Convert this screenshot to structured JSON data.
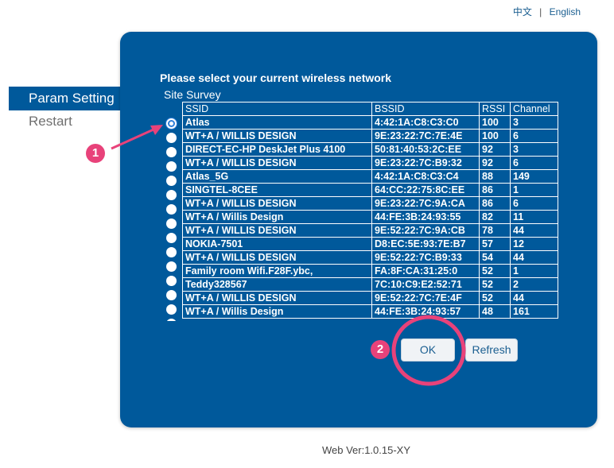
{
  "language": {
    "chinese": "中文",
    "separator": "|",
    "english": "English"
  },
  "sidebar": {
    "items": [
      {
        "label": "Param Setting",
        "active": true
      },
      {
        "label": "Restart",
        "active": false
      }
    ]
  },
  "panel": {
    "title": "Please select your current wireless network",
    "survey_label": "Site Survey",
    "columns": [
      "SSID",
      "BSSID",
      "RSSI",
      "Channel"
    ],
    "rows": [
      {
        "ssid": "Atlas",
        "bssid": "4:42:1A:C8:C3:C0",
        "rssi": "100",
        "channel": "3",
        "selected": true
      },
      {
        "ssid": "WT+A / WILLIS DESIGN",
        "bssid": "9E:23:22:7C:7E:4E",
        "rssi": "100",
        "channel": "6"
      },
      {
        "ssid": "DIRECT-EC-HP DeskJet Plus 4100",
        "bssid": "50:81:40:53:2C:EE",
        "rssi": "92",
        "channel": "3"
      },
      {
        "ssid": "WT+A / WILLIS DESIGN",
        "bssid": "9E:23:22:7C:B9:32",
        "rssi": "92",
        "channel": "6"
      },
      {
        "ssid": "Atlas_5G",
        "bssid": "4:42:1A:C8:C3:C4",
        "rssi": "88",
        "channel": "149"
      },
      {
        "ssid": "SINGTEL-8CEE",
        "bssid": "64:CC:22:75:8C:EE",
        "rssi": "86",
        "channel": "1"
      },
      {
        "ssid": "WT+A / WILLIS DESIGN",
        "bssid": "9E:23:22:7C:9A:CA",
        "rssi": "86",
        "channel": "6"
      },
      {
        "ssid": "WT+A / Willis Design",
        "bssid": "44:FE:3B:24:93:55",
        "rssi": "82",
        "channel": "11"
      },
      {
        "ssid": "WT+A / WILLIS DESIGN",
        "bssid": "9E:52:22:7C:9A:CB",
        "rssi": "78",
        "channel": "44"
      },
      {
        "ssid": "NOKIA-7501",
        "bssid": "D8:EC:5E:93:7E:B7",
        "rssi": "57",
        "channel": "12"
      },
      {
        "ssid": "WT+A / WILLIS DESIGN",
        "bssid": "9E:52:22:7C:B9:33",
        "rssi": "54",
        "channel": "44"
      },
      {
        "ssid": "Family room Wifi.F28F.ybc,",
        "bssid": "FA:8F:CA:31:25:0",
        "rssi": "52",
        "channel": "1"
      },
      {
        "ssid": "Teddy328567",
        "bssid": "7C:10:C9:E2:52:71",
        "rssi": "52",
        "channel": "2"
      },
      {
        "ssid": "WT+A / WILLIS DESIGN",
        "bssid": "9E:52:22:7C:7E:4F",
        "rssi": "52",
        "channel": "44"
      },
      {
        "ssid": "WT+A / Willis Design",
        "bssid": "44:FE:3B:24:93:57",
        "rssi": "48",
        "channel": "161"
      }
    ],
    "ok_label": "OK",
    "refresh_label": "Refresh"
  },
  "annotations": {
    "step1": "1",
    "step2": "2"
  },
  "footer": {
    "version": "Web Ver:1.0.15-XY"
  },
  "colors": {
    "panel": "#00599b",
    "highlight": "#e8427a"
  }
}
